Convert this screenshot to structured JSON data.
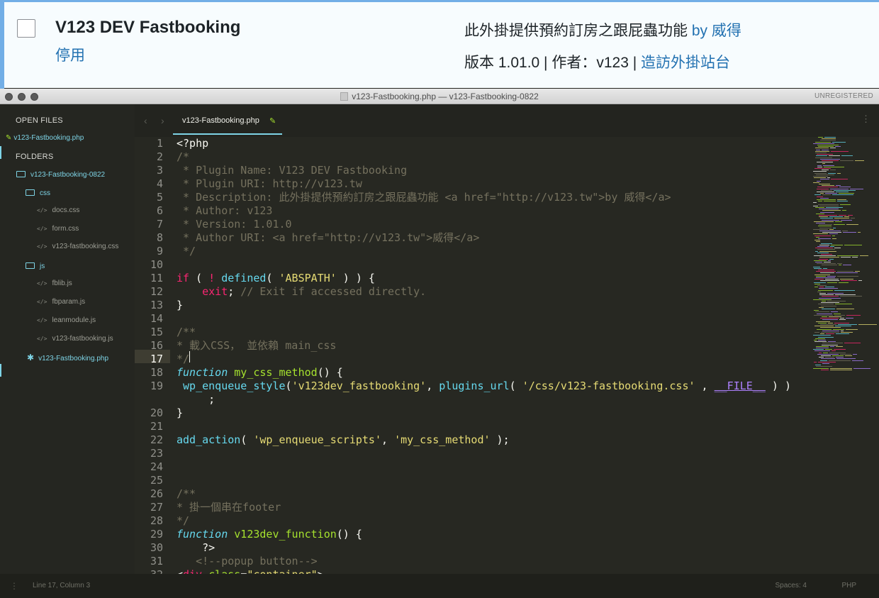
{
  "plugin": {
    "name": "V123 DEV Fastbooking",
    "deactivate_label": "停用",
    "description": "此外掛提供預約訂房之跟屁蟲功能",
    "by_label": "by",
    "author_link": "威得",
    "version_text": "版本 1.01.0 | 作者：v123 |",
    "site_link": "造訪外掛站台"
  },
  "window": {
    "title": "v123-Fastbooking.php — v123-Fastbooking-0822",
    "unregistered": "UNREGISTERED"
  },
  "sidebar": {
    "open_files_heading": "OPEN FILES",
    "open_file": "v123-Fastbooking.php",
    "folders_heading": "FOLDERS",
    "root_folder": "v123-Fastbooking-0822",
    "css_folder": "css",
    "css_files": [
      "docs.css",
      "form.css",
      "v123-fastbooking.css"
    ],
    "js_folder": "js",
    "js_files": [
      "fblib.js",
      "fbparam.js",
      "leanmodule.js",
      "v123-fastbooking.js"
    ],
    "root_file": "v123-Fastbooking.php"
  },
  "tab": {
    "label": "v123-Fastbooking.php"
  },
  "editor": {
    "line_numbers": [
      "1",
      "2",
      "3",
      "4",
      "5",
      "6",
      "7",
      "8",
      "9",
      "10",
      "11",
      "12",
      "13",
      "14",
      "15",
      "16",
      "17",
      "18",
      "19",
      "",
      "20",
      "21",
      "22",
      "23",
      "24",
      "25",
      "26",
      "27",
      "28",
      "29",
      "30",
      "31",
      "32"
    ],
    "current_line": "17",
    "lines": {
      "l1": "<?php",
      "l2": "/*",
      "l3": " * Plugin Name: V123 DEV Fastbooking",
      "l4": " * Plugin URI: http://v123.tw",
      "l5": " * Description: 此外掛提供預約訂房之跟屁蟲功能 <a href=\"http://v123.tw\">by 威得</a>",
      "l6": " * Author: v123",
      "l7": " * Version: 1.01.0",
      "l8": " * Author URI: <a href=\"http://v123.tw\">威得</a>",
      "l9": " */",
      "l11_if": "if",
      "l11_a": " ( ",
      "l11_not": "!",
      "l11_b": " ",
      "l11_defined": "defined",
      "l11_c": "( ",
      "l11_str": "'ABSPATH'",
      "l11_d": " ) ) {",
      "l12_indent": "    ",
      "l12_exit": "exit",
      "l12_semi": ";",
      "l12_com": " // Exit if accessed directly.",
      "l13": "}",
      "l15": "/**",
      "l16": "* 載入CSS， 並依賴 main_css",
      "l17": "*/",
      "l18_kw": "function",
      "l18_name": " my_css_method",
      "l18_rest": "() {",
      "l19_indent": " ",
      "l19_fn": "wp_enqueue_style",
      "l19_a": "(",
      "l19_s1": "'v123dev_fastbooking'",
      "l19_b": ", ",
      "l19_fn2": "plugins_url",
      "l19_c": "( ",
      "l19_s2": "'/css/v123-fastbooking.css'",
      "l19_d": " , ",
      "l19_const": "__FILE__",
      "l19_e": " ) )",
      "l19w": "     ;",
      "l20": "}",
      "l22_fn": "add_action",
      "l22_a": "( ",
      "l22_s1": "'wp_enqueue_scripts'",
      "l22_b": ", ",
      "l22_s2": "'my_css_method'",
      "l22_c": " );",
      "l26": "/**",
      "l27": "* 掛一個串在footer",
      "l28": "*/",
      "l29_kw": "function",
      "l29_name": " v123dev_function",
      "l29_rest": "() {",
      "l30": "    ?>",
      "l31": "   <!--popup button-->",
      "l32_a": "<",
      "l32_tag": "div",
      "l32_attr": " class",
      "l32_eq": "=",
      "l32_val": "\"container\"",
      "l32_end": ">"
    }
  },
  "status": {
    "position": "Line 17, Column 3",
    "spaces": "Spaces: 4",
    "syntax": "PHP"
  },
  "colors": {
    "monokai_bg": "#272822",
    "keyword": "#f92672",
    "function": "#a6e22e",
    "string": "#e6db74",
    "comment": "#75715e",
    "builtin": "#66d9ef",
    "constant": "#ae81ff",
    "wp_link": "#2271b1",
    "accent": "#7ed4e6"
  }
}
